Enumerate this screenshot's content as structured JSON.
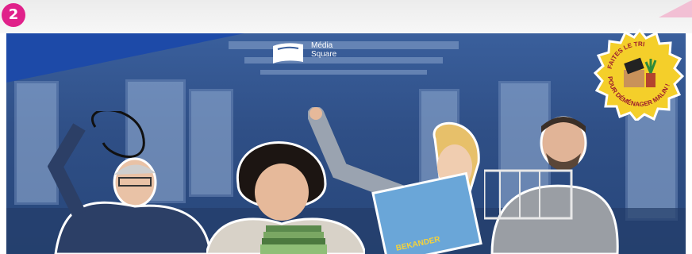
{
  "step": {
    "number": "2",
    "color": "#e0218a"
  },
  "logo": {
    "line1": "Média",
    "line2": "Square"
  },
  "badge": {
    "top_text": "FAITES LE TRI",
    "bottom_text": "POUR DÉMÉNAGER MALIN !",
    "color": "#f4cf2a"
  },
  "magazine": {
    "title": "BEKANDER"
  },
  "colors": {
    "accent_blue": "#1d4aa8",
    "background_blue": "#2f4f86"
  }
}
